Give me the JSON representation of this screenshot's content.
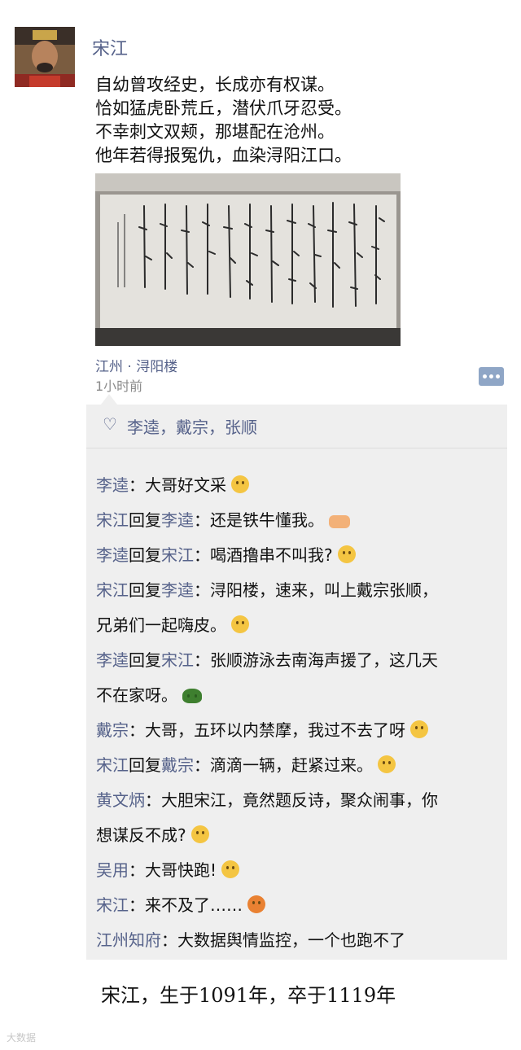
{
  "post": {
    "author": "宋江",
    "avatar_icon": "person-avatar-icon",
    "poem": [
      "自幼曾攻经史，长成亦有权谋。",
      "恰如猛虎卧荒丘，潜伏爪牙忍受。",
      "不幸刺文双颊，那堪配在沧州。",
      "他年若得报冤仇，血染浔阳江口。"
    ],
    "location": "江州 · 浔阳楼",
    "time": "1小时前",
    "comment_icon": "comment-menu-icon"
  },
  "likes": {
    "icon": "heart-icon",
    "names": "李逵，戴宗，张顺"
  },
  "comments": [
    {
      "name": "李逵",
      "reply_to": "",
      "text": "大哥好文采",
      "emoji": "grin-emoji-icon"
    },
    {
      "name": "宋江",
      "reply_to": "李逵",
      "text": "还是铁牛懂我。",
      "emoji": "handshake-emoji-icon"
    },
    {
      "name": "李逵",
      "reply_to": "宋江",
      "text": "喝酒撸串不叫我?",
      "emoji": "sad-emoji-icon"
    },
    {
      "name": "宋江",
      "reply_to": "李逵",
      "text": "浔阳楼，速来，叫上戴宗张顺，",
      "cont": "兄弟们一起嗨皮。",
      "emoji": "laugh-emoji-icon"
    },
    {
      "name": "李逵",
      "reply_to": "宋江",
      "text": "张顺游泳去南海声援了，这几天",
      "cont": "不在家呀。",
      "emoji": "turtle-emoji-icon"
    },
    {
      "name": "戴宗",
      "reply_to": "",
      "text": "大哥，五环以内禁摩，我过不去了呀",
      "emoji": "cry-emoji-icon"
    },
    {
      "name": "宋江",
      "reply_to": "戴宗",
      "text": "滴滴一辆，赶紧过来。",
      "emoji": "cool-emoji-icon"
    },
    {
      "name": "黄文炳",
      "reply_to": "",
      "text": "大胆宋江，竟然题反诗，聚众闹事，你",
      "cont": "想谋反不成?",
      "emoji": "smirk-emoji-icon"
    },
    {
      "name": "吴用",
      "reply_to": "",
      "text": "大哥快跑!",
      "emoji": "shock-emoji-icon"
    },
    {
      "name": "宋江",
      "reply_to": "",
      "text": "来不及了……",
      "emoji": "angry-emoji-icon"
    },
    {
      "name": "江州知府",
      "reply_to": "",
      "text": "大数据舆情监控，一个也跑不了",
      "emoji": ""
    }
  ],
  "labels": {
    "reply_word": "回复",
    "colon": "："
  },
  "footer": "宋江，生于1091年，卒于1119年",
  "watermark": "大数据"
}
